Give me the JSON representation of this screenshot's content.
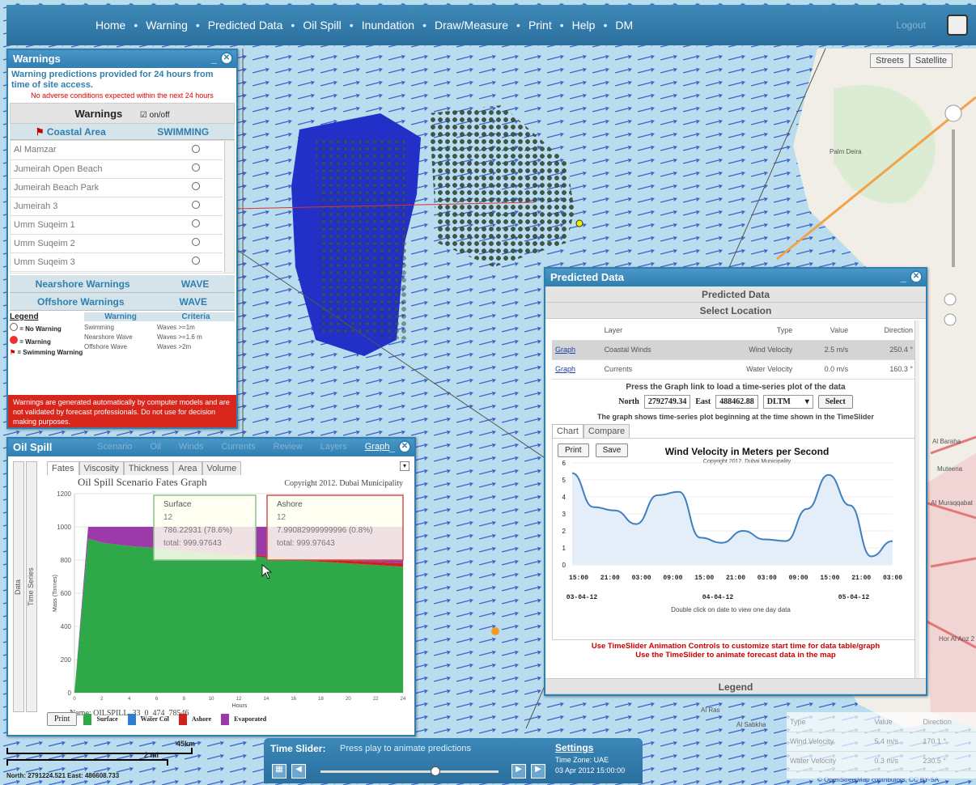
{
  "nav": {
    "items": [
      "Home",
      "Warning",
      "Predicted Data",
      "Oil Spill",
      "Inundation",
      "Draw/Measure",
      "Print",
      "Help",
      "DM"
    ],
    "login": "Logout"
  },
  "map_buttons": [
    "Streets",
    "Satellite"
  ],
  "map_labels": {
    "palm": "Palm Deira",
    "baraha": "Al Baraha",
    "muteena": "Muteena",
    "murqqabat": "Al Muraqqabat",
    "hor": "Hor Al Anz 2",
    "ras": "Al Ras",
    "sabkha": "Al Sabkha",
    "attrib": "© OpenStreetMap contributors, CC BY-SA"
  },
  "warnings": {
    "title": "Warnings",
    "note": "Warning predictions provided for 24 hours from time of site access.",
    "adverse": "No adverse conditions expected within the next 24 hours",
    "header": "Warnings",
    "onoff": "on/off",
    "col1": "Coastal Area",
    "col2": "SWIMMING",
    "areas": [
      "Al Mamzar",
      "Jumeirah Open Beach",
      "Jumeirah Beach Park",
      "Jumeirah 3",
      "Umm Suqeim 1",
      "Umm Suqeim 2",
      "Umm Suqeim 3"
    ],
    "nearshore": "Nearshore Warnings",
    "nearshore_v": "WAVE",
    "offshore": "Offshore Warnings",
    "offshore_v": "WAVE",
    "legend": "Legend",
    "leg_w": "Warning",
    "leg_c": "Criteria",
    "leg_items": [
      "= No Warning",
      "= Warning",
      "= Swimming Warning"
    ],
    "crit": [
      [
        "Swimming",
        "Waves >=1m"
      ],
      [
        "Nearshore Wave",
        "Waves >=1.6 m"
      ],
      [
        "Offshore Wave",
        "Waves >2m"
      ]
    ],
    "disclaimer": "Warnings are generated automatically by computer models and are not validated by forecast professionals. Do not use for decision making purposes."
  },
  "oil": {
    "title": "Oil Spill",
    "menu": [
      "Scenario",
      "Oil",
      "Winds",
      "Currents",
      "Review",
      "Layers",
      "Graph"
    ],
    "tabs": [
      "Fates",
      "Viscosity",
      "Thickness",
      "Area",
      "Volume"
    ],
    "side": [
      "Data",
      "Time Series"
    ],
    "gtitle": "Oil Spill Scenario Fates Graph",
    "copy": "Copyright 2012. Dubai Municipality",
    "ylabel": "Mass (Tonnes)",
    "xlabel": "Hours",
    "name": "Name: OILSPILL_33_0_474_78546",
    "tip1": {
      "t": "Surface",
      "a": "12",
      "b": "786.22931 (78.6%)",
      "c": "total: 999.97643"
    },
    "tip2": {
      "t": "Ashore",
      "a": "12",
      "b": "7.99082999999996 (0.8%)",
      "c": "total: 999.97643"
    },
    "print": "Print",
    "legend": [
      "Surface",
      "Water Col",
      "Ashore",
      "Evaporated"
    ]
  },
  "pred": {
    "title": "Predicted Data",
    "bar1": "Predicted Data",
    "bar2": "Select Location",
    "cols": [
      "Layer",
      "Type",
      "Value",
      "Direction"
    ],
    "rows": [
      [
        "Graph",
        "Coastal Winds",
        "Wind Velocity",
        "2.5 m/s",
        "250.4 °"
      ],
      [
        "Graph",
        "Currents",
        "Water Velocity",
        "0.0 m/s",
        "160.3 °"
      ]
    ],
    "press": "Press the Graph link to load a time-series plot of the data",
    "north_l": "North",
    "north": "2792749.34",
    "east_l": "East",
    "east": "488462.88",
    "coord": "DLTM",
    "select": "Select",
    "shows": "The graph shows time-series plot beginning at the time shown in the TimeSlider",
    "tabs": [
      "Chart",
      "Compare"
    ],
    "print": "Print",
    "save": "Save",
    "ctitle": "Wind Velocity in Meters per Second",
    "copy": "Copyright 2012. Dubai Municipality",
    "dates": [
      "03-04-12",
      "04-04-12",
      "05-04-12"
    ],
    "dbl": "Double click on date to view one day data",
    "msg1": "Use TimeSlider Animation Controls to customize start time for data table/graph",
    "msg2": "Use the TimeSlider to animate forecast data in the map",
    "legend": "Legend"
  },
  "slider": {
    "label": "Time Slider:",
    "hint": "Press play to animate predictions",
    "settings": "Settings",
    "tz": "Time Zone: UAE",
    "date": "03 Apr 2012 15:00:00"
  },
  "mini": {
    "cols": [
      "Type",
      "Value",
      "Direction"
    ],
    "rows": [
      [
        "Wind Velocity",
        "5.4 m/s",
        "170.1 °"
      ],
      [
        "Water Velocity",
        "0.3 m/s",
        "230.5 °"
      ]
    ]
  },
  "scale": {
    "a": "45km",
    "b": "2 mi",
    "coords": "North: 2791224.521  East: 486608.733"
  },
  "chart_data": [
    {
      "type": "area",
      "title": "Oil Spill Scenario Fates Graph",
      "xlabel": "Hours",
      "ylabel": "Mass (Tonnes)",
      "ylim": [
        0,
        1200
      ],
      "xlim": [
        0,
        24
      ],
      "x": [
        0,
        1,
        2,
        4,
        6,
        8,
        10,
        12,
        14,
        16,
        18,
        20,
        22,
        24
      ],
      "series": [
        {
          "name": "Surface",
          "values": [
            0,
            930,
            905,
            885,
            870,
            855,
            840,
            828,
            815,
            800,
            790,
            780,
            770,
            760
          ]
        },
        {
          "name": "Ashore",
          "values": [
            0,
            0,
            0,
            0,
            2,
            4,
            6,
            8,
            10,
            12,
            14,
            16,
            18,
            20
          ]
        },
        {
          "name": "Evaporated",
          "values": [
            0,
            70,
            95,
            115,
            128,
            141,
            154,
            164,
            175,
            188,
            196,
            204,
            212,
            220
          ]
        },
        {
          "name": "Water Col",
          "values": [
            0,
            0,
            0,
            0,
            0,
            0,
            0,
            0,
            0,
            0,
            0,
            0,
            0,
            0
          ]
        }
      ]
    },
    {
      "type": "line",
      "title": "Wind Velocity in Meters per Second",
      "ylim": [
        0,
        6
      ],
      "categories": [
        "15:00",
        "21:00",
        "03:00",
        "09:00",
        "15:00",
        "21:00",
        "03:00",
        "09:00",
        "15:00",
        "21:00",
        "03:00"
      ],
      "values": [
        5.4,
        3.4,
        3.2,
        2.4,
        4.1,
        4.3,
        1.6,
        1.3,
        2.0,
        1.5,
        1.4,
        3.3,
        5.3,
        3.5,
        0.5,
        1.4
      ]
    }
  ]
}
